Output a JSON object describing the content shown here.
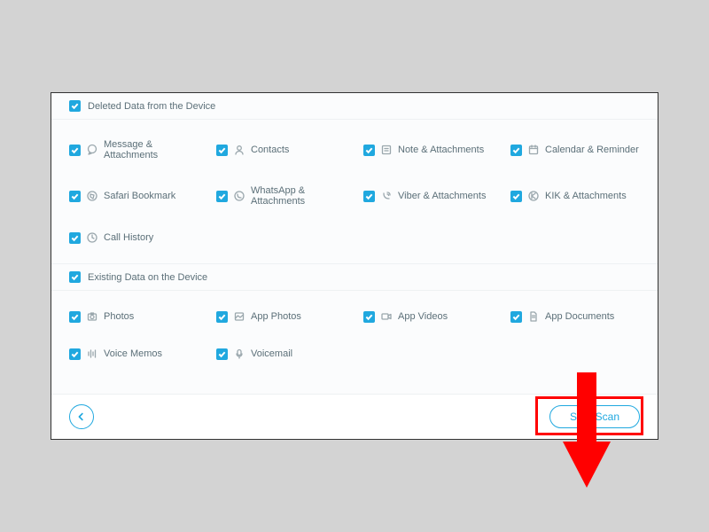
{
  "sections": {
    "deleted": {
      "label": "Deleted Data from the Device",
      "items": [
        {
          "label": "Message & Attachments",
          "icon": "message"
        },
        {
          "label": "Contacts",
          "icon": "contacts"
        },
        {
          "label": "Note & Attachments",
          "icon": "note"
        },
        {
          "label": "Calendar & Reminder",
          "icon": "calendar"
        },
        {
          "label": "Safari Bookmark",
          "icon": "bookmark"
        },
        {
          "label": "WhatsApp & Attachments",
          "icon": "whatsapp"
        },
        {
          "label": "Viber & Attachments",
          "icon": "viber"
        },
        {
          "label": "KIK & Attachments",
          "icon": "kik"
        },
        {
          "label": "Call History",
          "icon": "callhistory"
        }
      ]
    },
    "existing": {
      "label": "Existing Data on the Device",
      "items": [
        {
          "label": "Photos",
          "icon": "photos"
        },
        {
          "label": "App Photos",
          "icon": "appphotos"
        },
        {
          "label": "App Videos",
          "icon": "appvideos"
        },
        {
          "label": "App Documents",
          "icon": "appdocs"
        },
        {
          "label": "Voice Memos",
          "icon": "voicememos"
        },
        {
          "label": "Voicemail",
          "icon": "voicemail"
        }
      ]
    }
  },
  "footer": {
    "scan_label": "Start Scan"
  }
}
